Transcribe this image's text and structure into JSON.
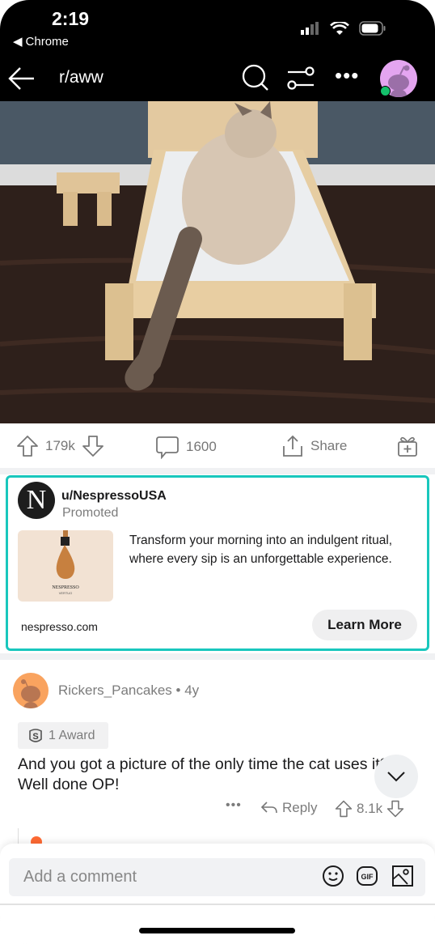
{
  "status_bar": {
    "time": "2:19",
    "back_app": "Chrome"
  },
  "nav": {
    "title": "r/aww",
    "icons": [
      "back-arrow-icon",
      "search-icon",
      "filter-icon",
      "more-icon",
      "avatar"
    ]
  },
  "post": {
    "upvotes": "179k",
    "comments": "1600",
    "share_label": "Share",
    "image_alt": "Cat lying on a small wooden bed"
  },
  "ad": {
    "username": "u/NespressoUSA",
    "label": "Promoted",
    "body": "Transform your morning into an indulgent ritual, where every sip is an unforgettable experience.",
    "thumb_brand": "NESPRESSO",
    "thumb_sub": "VERTUO",
    "domain": "nespresso.com",
    "cta": "Learn More",
    "accent": "#19c7bd"
  },
  "comment": {
    "author": "Rickers_Pancakes",
    "age": "4y",
    "award": "1 Award",
    "text": "And you got a picture of the only time the cat uses it? Well done OP!",
    "reply_label": "Reply",
    "score": "8.1k"
  },
  "composer": {
    "placeholder": "Add a comment",
    "gif_label": "GIF"
  }
}
